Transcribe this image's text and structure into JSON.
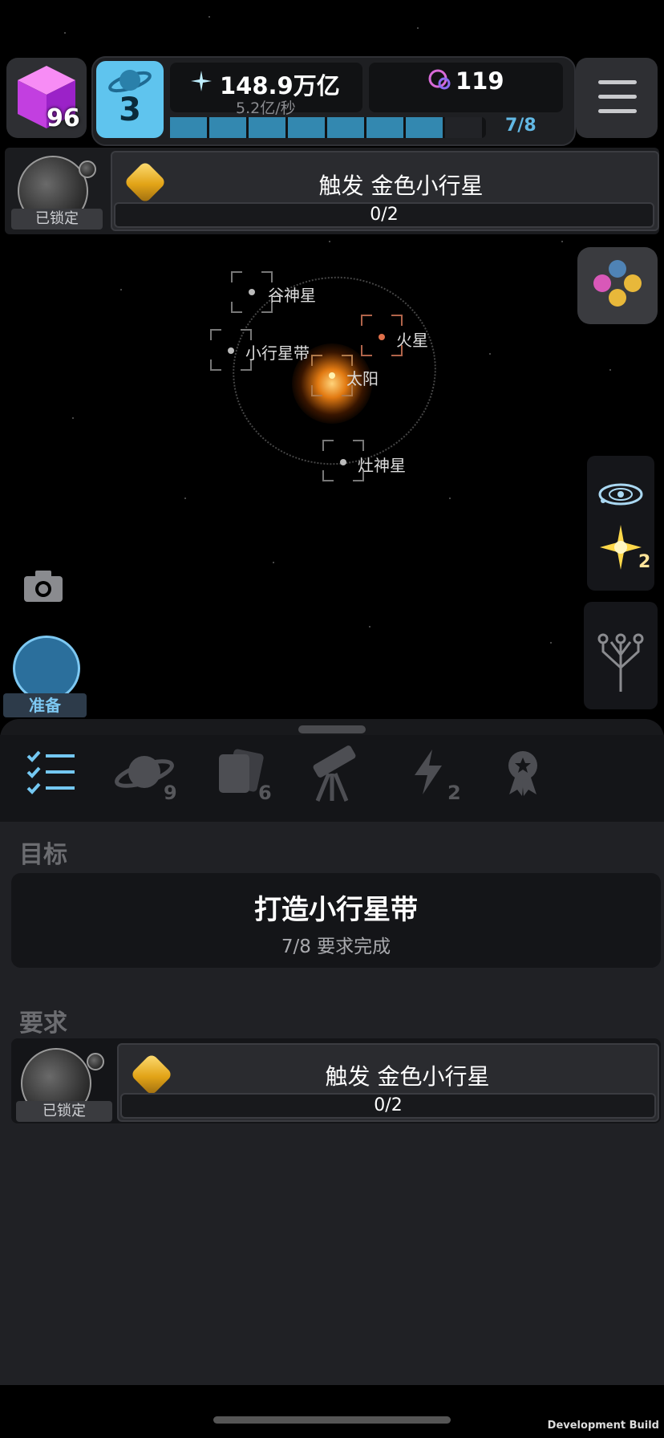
{
  "hud": {
    "cube_count": "96",
    "level": "3",
    "energy_value": "148.9万亿",
    "energy_rate": "5.2亿/秒",
    "dust_value": "119",
    "progress_text": "7/8",
    "progress_fraction": 0.875
  },
  "quest": {
    "locked_label": "已锁定",
    "task_title": "触发 金色小行星",
    "task_progress": "0/2"
  },
  "map": {
    "planets": {
      "ceres": "谷神星",
      "mars": "火星",
      "asteroid_belt": "小行星带",
      "sun": "太阳",
      "vesta": "灶神星"
    }
  },
  "side": {
    "burst_count": "2",
    "warp_label": "准备"
  },
  "tabs": {
    "planets_count": "9",
    "cards_count": "6",
    "energy_count": "2"
  },
  "panel": {
    "goal_heading": "目标",
    "goal_title": "打造小行星带",
    "goal_sub": "7/8 要求完成",
    "req_heading": "要求",
    "req_locked_label": "已锁定",
    "req_task_title": "触发 金色小行星",
    "req_task_progress": "0/2"
  },
  "footer": {
    "dev_build": "Development Build"
  },
  "colors": {
    "accent_blue": "#5fc4ee",
    "progress_blue": "#3388b0",
    "gold": "#e2a417",
    "mars": "#e0704a"
  }
}
